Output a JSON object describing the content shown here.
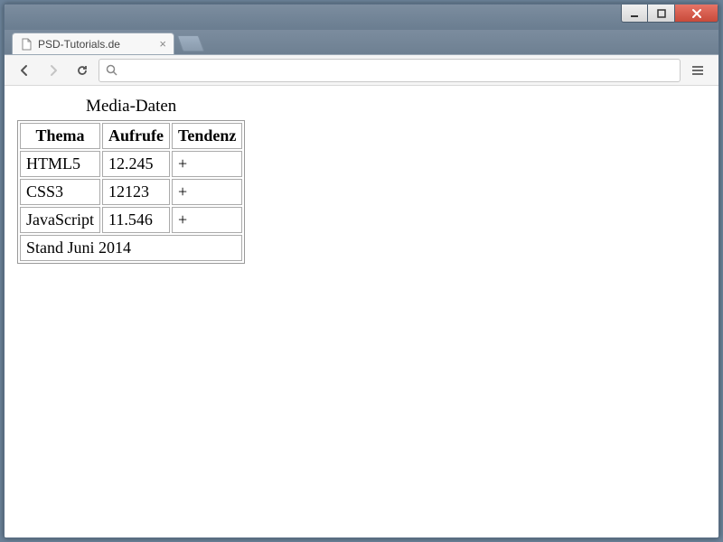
{
  "window": {
    "tab_title": "PSD-Tutorials.de"
  },
  "page": {
    "caption": "Media-Daten",
    "headers": {
      "thema": "Thema",
      "aufrufe": "Aufrufe",
      "tendenz": "Tendenz"
    },
    "rows": [
      {
        "thema": "HTML5",
        "aufrufe": "12.245",
        "tendenz": "+"
      },
      {
        "thema": "CSS3",
        "aufrufe": "12123",
        "tendenz": "+"
      },
      {
        "thema": "JavaScript",
        "aufrufe": "11.546",
        "tendenz": "+"
      }
    ],
    "footer": "Stand Juni 2014"
  },
  "chart_data": {
    "type": "table",
    "title": "Media-Daten",
    "columns": [
      "Thema",
      "Aufrufe",
      "Tendenz"
    ],
    "rows": [
      [
        "HTML5",
        "12.245",
        "+"
      ],
      [
        "CSS3",
        "12123",
        "+"
      ],
      [
        "JavaScript",
        "11.546",
        "+"
      ]
    ],
    "footer": "Stand Juni 2014"
  }
}
